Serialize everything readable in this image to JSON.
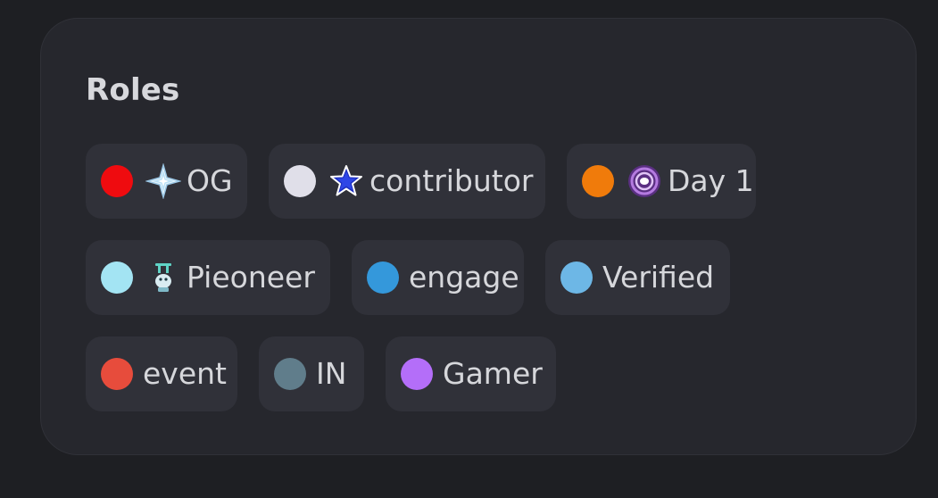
{
  "roles_panel": {
    "title": "Roles",
    "roles": [
      {
        "label": "OG",
        "color": "#ef0b0f",
        "icon": "sparkle-star-icon"
      },
      {
        "label": "contributor",
        "color": "#e0dfe9",
        "icon": "blue-star-icon"
      },
      {
        "label": "Day 1",
        "color": "#f07b0b",
        "icon": "galaxy-icon"
      },
      {
        "label": "Pieoneer",
        "color": "#a3e4f3",
        "icon": "pie-trophy-icon"
      },
      {
        "label": "engage",
        "color": "#3498db",
        "icon": null
      },
      {
        "label": "Verified",
        "color": "#6db7e6",
        "icon": null
      },
      {
        "label": "event",
        "color": "#e74c3c",
        "icon": null
      },
      {
        "label": "IN",
        "color": "#607d8b",
        "icon": null
      },
      {
        "label": "Gamer",
        "color": "#b46ef9",
        "icon": null
      }
    ]
  }
}
